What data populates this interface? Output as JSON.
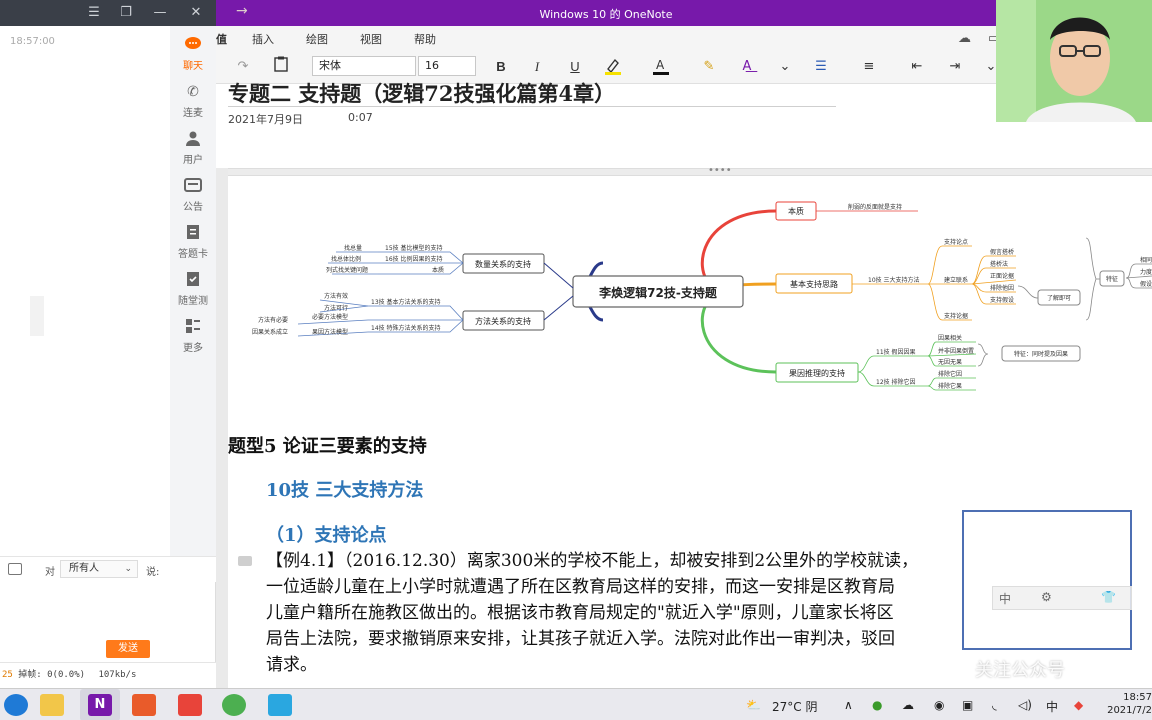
{
  "left_panel": {
    "time": "18:57:00",
    "nav": [
      {
        "label": "聊天",
        "icon": "chat-icon"
      },
      {
        "label": "连麦",
        "icon": "phone-icon"
      },
      {
        "label": "用户",
        "icon": "user-icon"
      },
      {
        "label": "公告",
        "icon": "announcement-icon"
      },
      {
        "label": "答题卡",
        "icon": "answer-card-icon"
      },
      {
        "label": "随堂测",
        "icon": "quiz-icon"
      },
      {
        "label": "更多",
        "icon": "more-grid-icon"
      }
    ],
    "chat_to": "对",
    "chat_target": "所有人",
    "chat_say": "说:",
    "send_label": "发送",
    "stats_prefix": "25",
    "stats_text": "掉帧: 0(0.0%)",
    "stats_speed": "107kb/s"
  },
  "onenote": {
    "window_title": "Windows 10 的 OneNote",
    "menu": [
      "插入",
      "绘图",
      "视图",
      "帮助"
    ],
    "menu_cut": "值",
    "font_name": "宋体",
    "font_size": "16",
    "page_title": "专题二 支持题（逻辑72技强化篇第4章）",
    "page_date": "2021年7月9日",
    "page_time": "0:07"
  },
  "mindmap": {
    "center": "李焕逻辑72技-支持题",
    "left_branches": [
      {
        "label": "数量关系的支持",
        "leaves": [
          {
            "pre": "找总量",
            "label": "15技 基比模型的支持"
          },
          {
            "pre": "找总体比例",
            "label": "16技 比例因果的支持"
          },
          {
            "pre": "列式找关键问题",
            "label": "本质"
          }
        ]
      },
      {
        "label": "方法关系的支持",
        "leaves": [
          {
            "pre": "方法有效",
            "label": "13技 基本方法关系的支持"
          },
          {
            "pre": "方法可行",
            "label": ""
          },
          {
            "pre": "方法有必要",
            "label": "必要方法模型"
          },
          {
            "pre": "因果关系成立",
            "label": "14技 特殊方法关系的支持"
          },
          {
            "pre": "",
            "label": "果因方法模型"
          }
        ]
      }
    ],
    "right_branches": [
      {
        "label": "本质",
        "note": "削弱的反面就是支持"
      },
      {
        "label": "基本支持思路",
        "note": "10技 三大支持方法",
        "items": [
          "支持论点",
          "建立联系",
          "支持论据"
        ],
        "subitems": [
          "假言搭桥",
          "搭桥法",
          "正面论据",
          "排除他因",
          "支持假设"
        ],
        "tag": "了解即可",
        "feature": "特征",
        "far": [
          "相同",
          "力度",
          "假设"
        ]
      },
      {
        "label": "果因推理的支持",
        "items": [
          "11技 假因因果",
          "12技 排除它因"
        ],
        "subitems": [
          "因果相关",
          "并非因果倒置",
          "无因无果",
          "排除它因",
          "排除它果"
        ],
        "feature": "特征：同时提及因果"
      }
    ]
  },
  "body": {
    "h5": "题型5 论证三要素的支持",
    "h10": "10技 三大支持方法",
    "h1": "（1）支持论点",
    "lines": [
      "【例4.1】（2016.12.30）离家300米的学校不能上，却被安排到2公里外的学校就读，",
      "一位适龄儿童在上小学时就遭遇了所在区教育局这样的安排，而这一安排是区教育局",
      "儿童户籍所在施教区做出的。根据该市教育局规定的\"就近入学\"原则，儿童家长将区",
      "局告上法院，要求撤销原来安排，让其孩子就近入学。法院对此作出一审判决，驳回",
      "请求。"
    ]
  },
  "overlay": {
    "ime_text": "中",
    "watermark": "关注公众号"
  },
  "taskbar": {
    "weather": "27°C 阴",
    "ime": "中",
    "time": "18:57",
    "date": "2021/7/2"
  },
  "colors": {
    "onenote_purple": "#7719aa",
    "accent_orange": "#ff6a00",
    "heading_blue": "#2e75b6",
    "branch_red": "#e8433a",
    "branch_orange": "#f0a020",
    "branch_green": "#5cc25a",
    "branch_navy": "#2a3a8a"
  }
}
